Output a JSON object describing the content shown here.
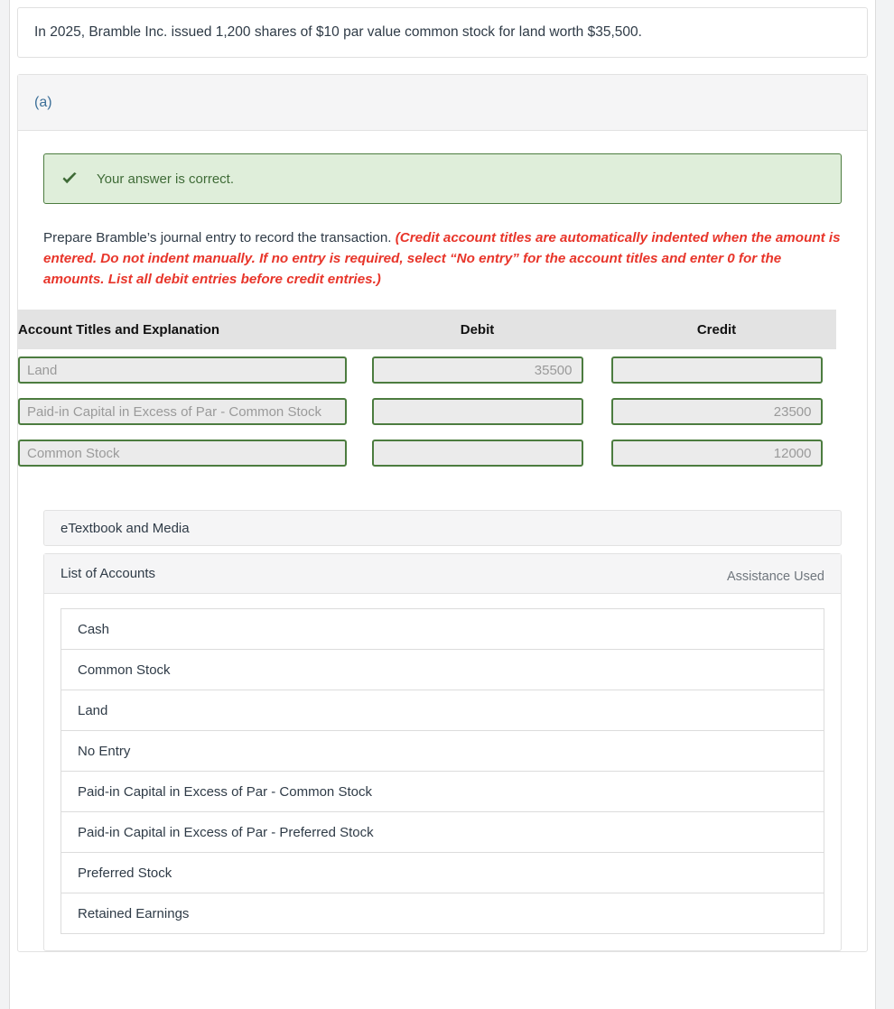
{
  "question": {
    "text": "In 2025, Bramble Inc. issued 1,200 shares of $10 par value common stock for land worth $35,500."
  },
  "part": {
    "label": "(a)"
  },
  "banner": {
    "icon": "check-icon",
    "text": "Your answer is correct.",
    "background_color": "#dfeeda",
    "border_color": "#4c7c3f",
    "text_color": "#3f6b37"
  },
  "instruction": {
    "lead": "Prepare Bramble’s journal entry to record the transaction. ",
    "emphasis": "(Credit account titles are automatically indented when the amount is entered. Do not indent manually. If no entry is required, select “No entry” for the account titles and enter 0 for the amounts. List all debit entries before credit entries.)",
    "emphasis_color": "#e8352a"
  },
  "journal": {
    "headers": {
      "account": "Account Titles and Explanation",
      "debit": "Debit",
      "credit": "Credit"
    },
    "rows": [
      {
        "account": "Land",
        "debit": "35500",
        "credit": ""
      },
      {
        "account": "Paid-in Capital in Excess of Par - Common Stock",
        "debit": "",
        "credit": "23500"
      },
      {
        "account": "Common Stock",
        "debit": "",
        "credit": "12000"
      }
    ],
    "field_border_color": "#4c7c3f",
    "field_background_color": "#ebebeb"
  },
  "etextbook": {
    "label": "eTextbook and Media"
  },
  "accounts": {
    "title": "List of Accounts",
    "assistance": "Assistance Used",
    "items": [
      {
        "label": "Cash"
      },
      {
        "label": "Common Stock"
      },
      {
        "label": "Land"
      },
      {
        "label": "No Entry"
      },
      {
        "label": "Paid-in Capital in Excess of Par - Common Stock"
      },
      {
        "label": "Paid-in Capital in Excess of Par - Preferred Stock"
      },
      {
        "label": "Preferred Stock"
      },
      {
        "label": "Retained Earnings"
      }
    ]
  }
}
